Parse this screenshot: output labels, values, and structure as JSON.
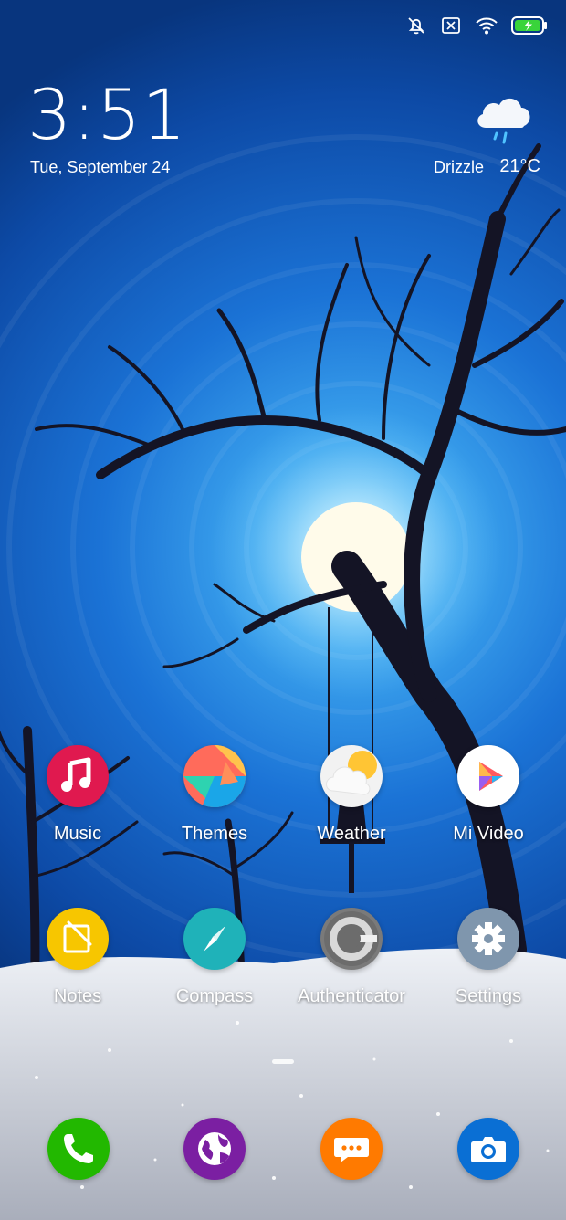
{
  "status_bar": {
    "icons": [
      "mute-vibrate-icon",
      "no-sim-icon",
      "wifi-icon",
      "battery-charging-icon"
    ]
  },
  "clock": {
    "time": "3:51",
    "date": "Tue, September 24"
  },
  "weather": {
    "condition": "Drizzle",
    "temperature": "21°C",
    "icon": "cloud-drizzle-icon"
  },
  "apps": [
    {
      "label": "Music",
      "icon": "music-note-icon",
      "color": "#e0194f"
    },
    {
      "label": "Themes",
      "icon": "themes-icon",
      "color": "#ff6b5b"
    },
    {
      "label": "Weather",
      "icon": "weather-sun-cloud-icon",
      "color": "#f2f2f2"
    },
    {
      "label": "Mi Video",
      "icon": "play-icon",
      "color": "#ffffff"
    },
    {
      "label": "Notes",
      "icon": "notes-icon",
      "color": "#f7c600"
    },
    {
      "label": "Compass",
      "icon": "compass-icon",
      "color": "#1fb2b9"
    },
    {
      "label": "Authenticator",
      "icon": "authenticator-icon",
      "color": "#7a7a7a"
    },
    {
      "label": "Settings",
      "icon": "gear-icon",
      "color": "#7f96ad"
    }
  ],
  "dock": [
    {
      "icon": "phone-icon",
      "color": "#22b800"
    },
    {
      "icon": "browser-globe-icon",
      "color": "#7b1fa2"
    },
    {
      "icon": "messages-icon",
      "color": "#ff7a00"
    },
    {
      "icon": "camera-icon",
      "color": "#0a6fd4"
    }
  ]
}
